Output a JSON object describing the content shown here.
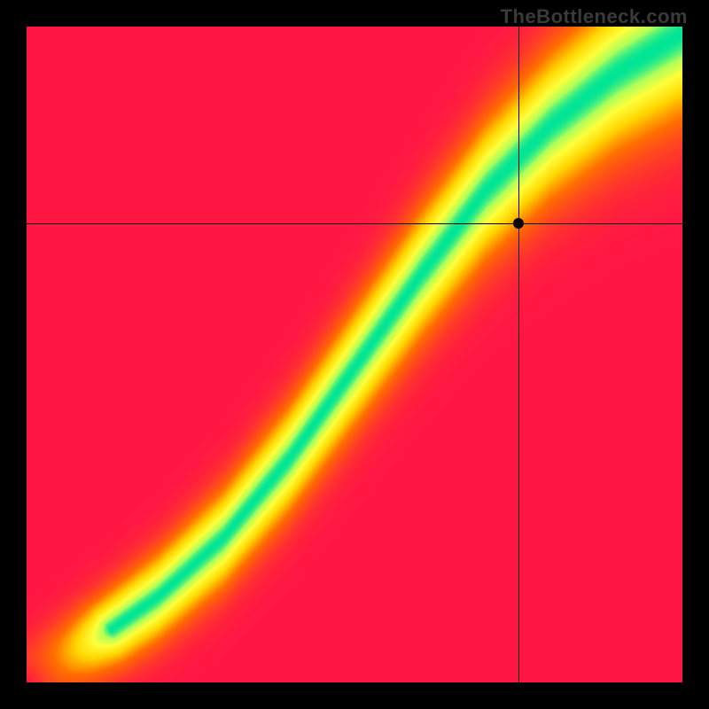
{
  "watermark": "TheBottleneck.com",
  "chart_data": {
    "type": "heatmap",
    "title": "",
    "xlabel": "",
    "ylabel": "",
    "xlim": [
      0,
      1
    ],
    "ylim": [
      0,
      1
    ],
    "grid": false,
    "legend": null,
    "crosshair": {
      "x": 0.75,
      "y": 0.7
    },
    "marker": {
      "x": 0.75,
      "y": 0.7
    },
    "ridge_curve": {
      "description": "S-shaped green ridge through the red-yellow field; points are (x, y_center) of peak compatibility",
      "points": [
        [
          0.0,
          0.0
        ],
        [
          0.1,
          0.06
        ],
        [
          0.2,
          0.13
        ],
        [
          0.3,
          0.22
        ],
        [
          0.4,
          0.34
        ],
        [
          0.5,
          0.48
        ],
        [
          0.6,
          0.62
        ],
        [
          0.7,
          0.75
        ],
        [
          0.8,
          0.85
        ],
        [
          0.9,
          0.93
        ],
        [
          1.0,
          0.99
        ]
      ]
    },
    "color_stops": [
      {
        "t": 0.0,
        "color": "#ff1744"
      },
      {
        "t": 0.35,
        "color": "#ff6d00"
      },
      {
        "t": 0.6,
        "color": "#ffd600"
      },
      {
        "t": 0.8,
        "color": "#ffff3b"
      },
      {
        "t": 0.92,
        "color": "#b2ff59"
      },
      {
        "t": 1.0,
        "color": "#00e596"
      }
    ],
    "ridge_width": 0.06
  }
}
